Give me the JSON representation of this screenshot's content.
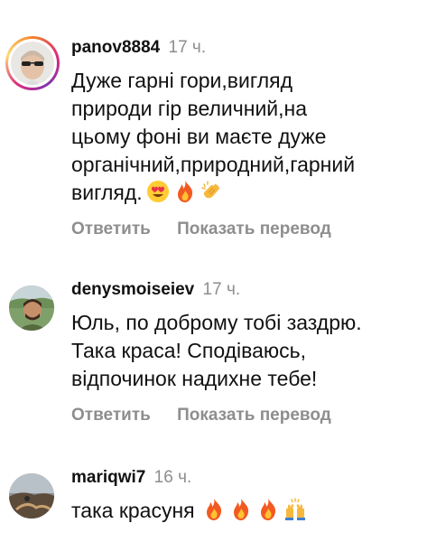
{
  "comments": [
    {
      "username": "panov8884",
      "time": "17 ч.",
      "text": "Дуже гарні гори,вигляд\nприроди гір величний,на\nцьому фоні ви маєте дуже\nорганічний,природний,гарний\nвигляд.",
      "emojis": [
        "heart-eyes-icon",
        "fire-icon",
        "clapping-hands-icon"
      ],
      "reply": "Ответить",
      "translate": "Показать перевод"
    },
    {
      "username": "denysmoiseiev",
      "time": "17 ч.",
      "text": "Юль, по доброму тобі заздрю.\nТака краса! Сподіваюсь,\nвідпочинок надихне тебе!",
      "reply": "Ответить",
      "translate": "Показать перевод"
    },
    {
      "username": "mariqwi7",
      "time": "16 ч.",
      "text": "така красуня",
      "emojis": [
        "fire-icon",
        "fire-icon",
        "fire-icon",
        "raising-hands-icon"
      ]
    }
  ]
}
